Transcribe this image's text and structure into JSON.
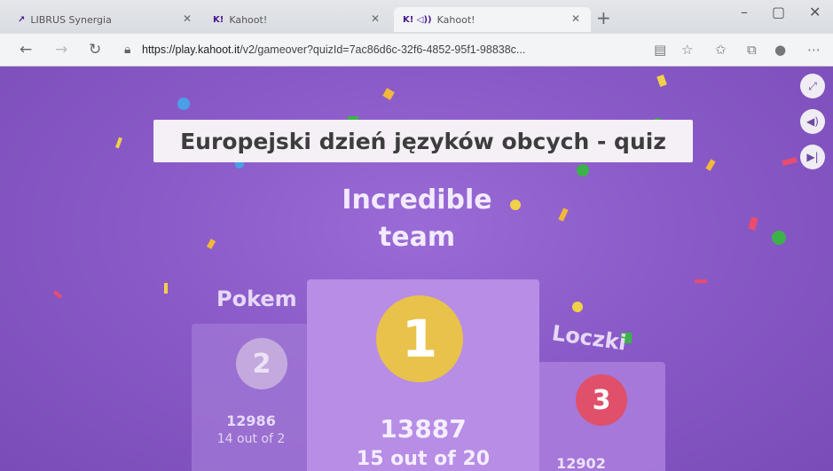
{
  "browser": {
    "tabs": [
      {
        "label": "LIBRUS Synergia",
        "favicon": "librus-icon"
      },
      {
        "label": "Kahoot!",
        "favicon": "K!"
      },
      {
        "label": "Kahoot!",
        "favicon": "K! ◁))"
      }
    ],
    "url_host": "https://play.kahoot.it",
    "url_path": "/v2/gameover?quizId=7ac86d6c-32f6-4852-95f1-98838c..."
  },
  "game": {
    "quiz_title": "Europejski dzień języków obcych - quiz",
    "heading_line1": "Incredible",
    "heading_line2": "team",
    "podium": [
      {
        "rank": "1",
        "score": "13887",
        "detail": "15 out of 20"
      },
      {
        "rank": "2",
        "name": "Pokem",
        "score": "12986",
        "detail": "14 out of 2"
      },
      {
        "rank": "3",
        "name": "Loczki",
        "score": "12902"
      }
    ]
  },
  "colors": {
    "background": "#8a5bc8",
    "gold": "#e8c24a",
    "bronze": "#e0506a",
    "silver": "#c4a9de"
  }
}
